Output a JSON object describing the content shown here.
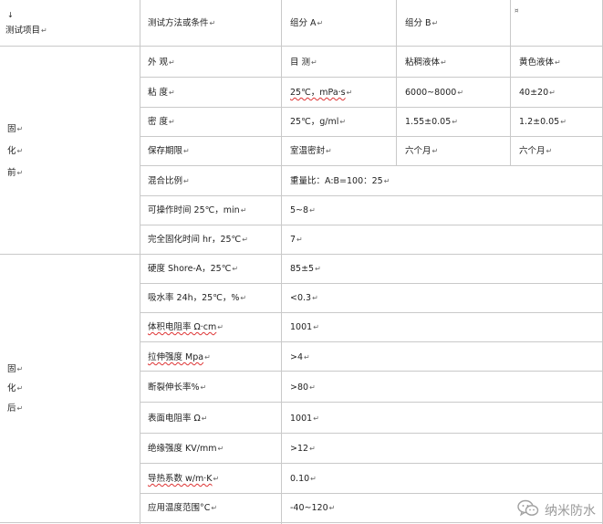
{
  "header": {
    "arrow": "↓",
    "item": "测试项目",
    "method": "测试方法或条件",
    "comp_a": "组分 A",
    "comp_b": "组分 B"
  },
  "section_before": [
    "固",
    "化",
    "前"
  ],
  "section_after": [
    "固",
    "化",
    "后"
  ],
  "rows_before": [
    {
      "name": "外 观",
      "method": "目 测",
      "a": "粘稠液体",
      "b": "黄色液体"
    },
    {
      "name": "粘 度",
      "method": "25℃，mPa·s",
      "a": "6000~8000",
      "b": "40±20"
    },
    {
      "name": "密 度",
      "method": "25℃，g/ml",
      "a": "1.55±0.05",
      "b": "1.2±0.05"
    },
    {
      "name": "保存期限",
      "method": "室温密封",
      "a": "六个月",
      "b": "六个月"
    },
    {
      "name": "混合比例",
      "value": "重量比：A:B=100：25"
    },
    {
      "name": "可操作时间 25℃，min",
      "value": "5~8"
    },
    {
      "name": "完全固化时间 hr，25℃",
      "value": "7"
    }
  ],
  "rows_after": [
    {
      "name": "硬度 Shore-A，25℃",
      "value": "85±5"
    },
    {
      "name": "吸水率 24h，25℃，%",
      "value": "<0.3"
    },
    {
      "name": "体积电阻率 Ω·cm",
      "value": "1001"
    },
    {
      "name": "拉伸强度 Mpa",
      "value": ">4"
    },
    {
      "name": "断裂伸长率%",
      "value": ">80"
    },
    {
      "name": "表面电阻率 Ω",
      "value": "1001"
    },
    {
      "name": "绝缘强度 KV/mm",
      "value": ">12"
    },
    {
      "name": "导热系数 w/m·K",
      "value": "0.10"
    },
    {
      "name": "应用温度范围°C",
      "value": "-40~120"
    }
  ],
  "watermark": "纳米防水",
  "watermark_icon": "wechat-icon",
  "colors": {
    "grid": "#c9c9c9",
    "text": "#222222",
    "watermark": "#9a9a9a"
  }
}
